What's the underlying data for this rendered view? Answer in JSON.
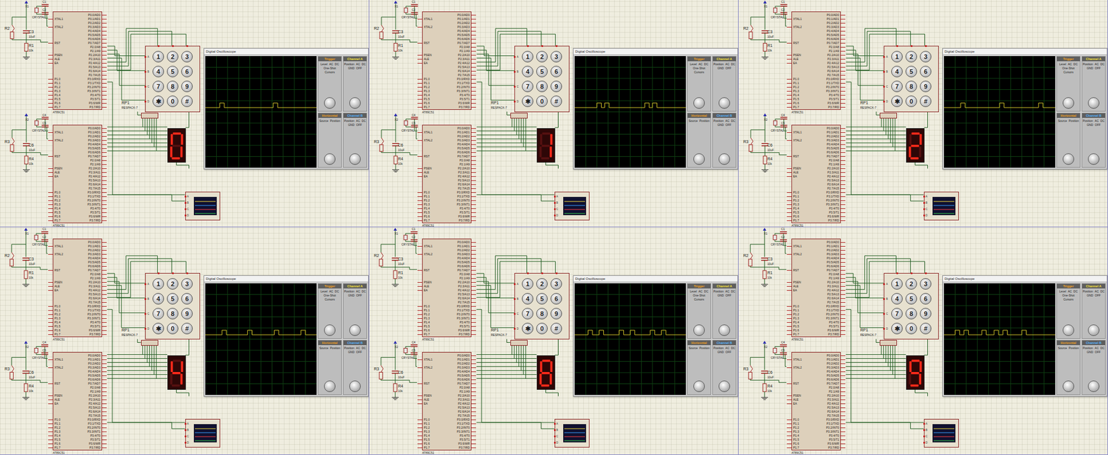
{
  "schematic": {
    "mcu_part": "AT89C51",
    "mcu_left_pins": [
      "XTAL1",
      "XTAL2",
      "RST",
      "PSEN",
      "ALE",
      "EA",
      "P1.0",
      "P1.1",
      "P1.2",
      "P1.3",
      "P1.4",
      "P1.5",
      "P1.6",
      "P1.7"
    ],
    "mcu_right_pins": [
      "P0.0/AD0",
      "P0.1/AD1",
      "P0.2/AD2",
      "P0.3/AD3",
      "P0.4/AD4",
      "P0.5/AD5",
      "P0.6/AD6",
      "P0.7/AD7",
      "P2.0/A8",
      "P2.1/A9",
      "P2.2/A10",
      "P2.3/A11",
      "P2.4/A12",
      "P2.5/A13",
      "P2.6/A14",
      "P2.7/A15",
      "P3.0/RXD",
      "P3.1/TXD",
      "P3.2/INT0",
      "P3.3/INT1",
      "P3.4/T0",
      "P3.5/T1",
      "P3.6/WR",
      "P3.7/RD"
    ],
    "upper_parts": {
      "c_a": "C1",
      "c_b": "C2",
      "xtal": "X1",
      "crystal": "CRYSTAL",
      "r_btn": "R2",
      "c_rst": "C3",
      "c_value": "10uF",
      "r_rst": "R1",
      "r_value": "10k"
    },
    "lower_parts": {
      "c_a": "C4",
      "c_b": "C5",
      "xtal": "X2",
      "crystal": "CRYSTAL",
      "r_btn": "R3",
      "c_rst": "C6",
      "c_value": "10uF",
      "r_rst": "R4",
      "r_value": "10k"
    },
    "resistor_pack": {
      "ref": "RP1",
      "part": "RESPACK-7"
    },
    "keypad_keys": [
      "1",
      "2",
      "3",
      "4",
      "5",
      "6",
      "7",
      "8",
      "9",
      "✱",
      "0",
      "#"
    ],
    "keypad_rows": [
      "A",
      "B",
      "C",
      "D"
    ],
    "probe_pins": [
      "A",
      "B",
      "C",
      "D"
    ]
  },
  "oscilloscope": {
    "title": "Digital Oscilloscope",
    "sections": [
      {
        "title": "Trigger",
        "color": "#f0a020",
        "items": [
          "Level",
          "AC",
          "DC",
          "One-Shot",
          "Cursors"
        ]
      },
      {
        "title": "Channel A",
        "color": "#f5e03a",
        "items": [
          "Position",
          "AC",
          "DC",
          "GND",
          "OFF"
        ]
      },
      {
        "title": "Horizontal",
        "color": "#f0a020",
        "items": [
          "Source",
          "Position"
        ]
      },
      {
        "title": "Channel B",
        "color": "#55b4ff",
        "items": [
          "Position",
          "AC",
          "DC",
          "GND",
          "OFF"
        ]
      }
    ]
  },
  "panels": [
    {
      "segments": [
        true,
        true,
        true,
        true,
        true,
        true,
        false
      ],
      "pulses": [
        0.13,
        0.61
      ]
    },
    {
      "segments": [
        false,
        true,
        true,
        false,
        false,
        false,
        false
      ],
      "pulses": [
        0.2,
        0.27,
        0.63,
        0.7
      ]
    },
    {
      "segments": [
        true,
        true,
        false,
        true,
        true,
        false,
        true
      ],
      "pulses": [
        0.15,
        0.5,
        0.85
      ]
    },
    {
      "segments": [
        false,
        true,
        true,
        false,
        false,
        true,
        true
      ],
      "pulses": [
        0.15,
        0.38,
        0.62,
        0.86
      ]
    },
    {
      "segments": [
        true,
        true,
        true,
        true,
        true,
        true,
        true
      ],
      "pulses": [
        0.12,
        0.22,
        0.4,
        0.5,
        0.68,
        0.78
      ]
    },
    {
      "segments": [
        true,
        true,
        true,
        true,
        false,
        true,
        true
      ],
      "pulses": [
        0.1,
        0.18,
        0.34,
        0.45,
        0.53,
        0.7
      ]
    }
  ]
}
